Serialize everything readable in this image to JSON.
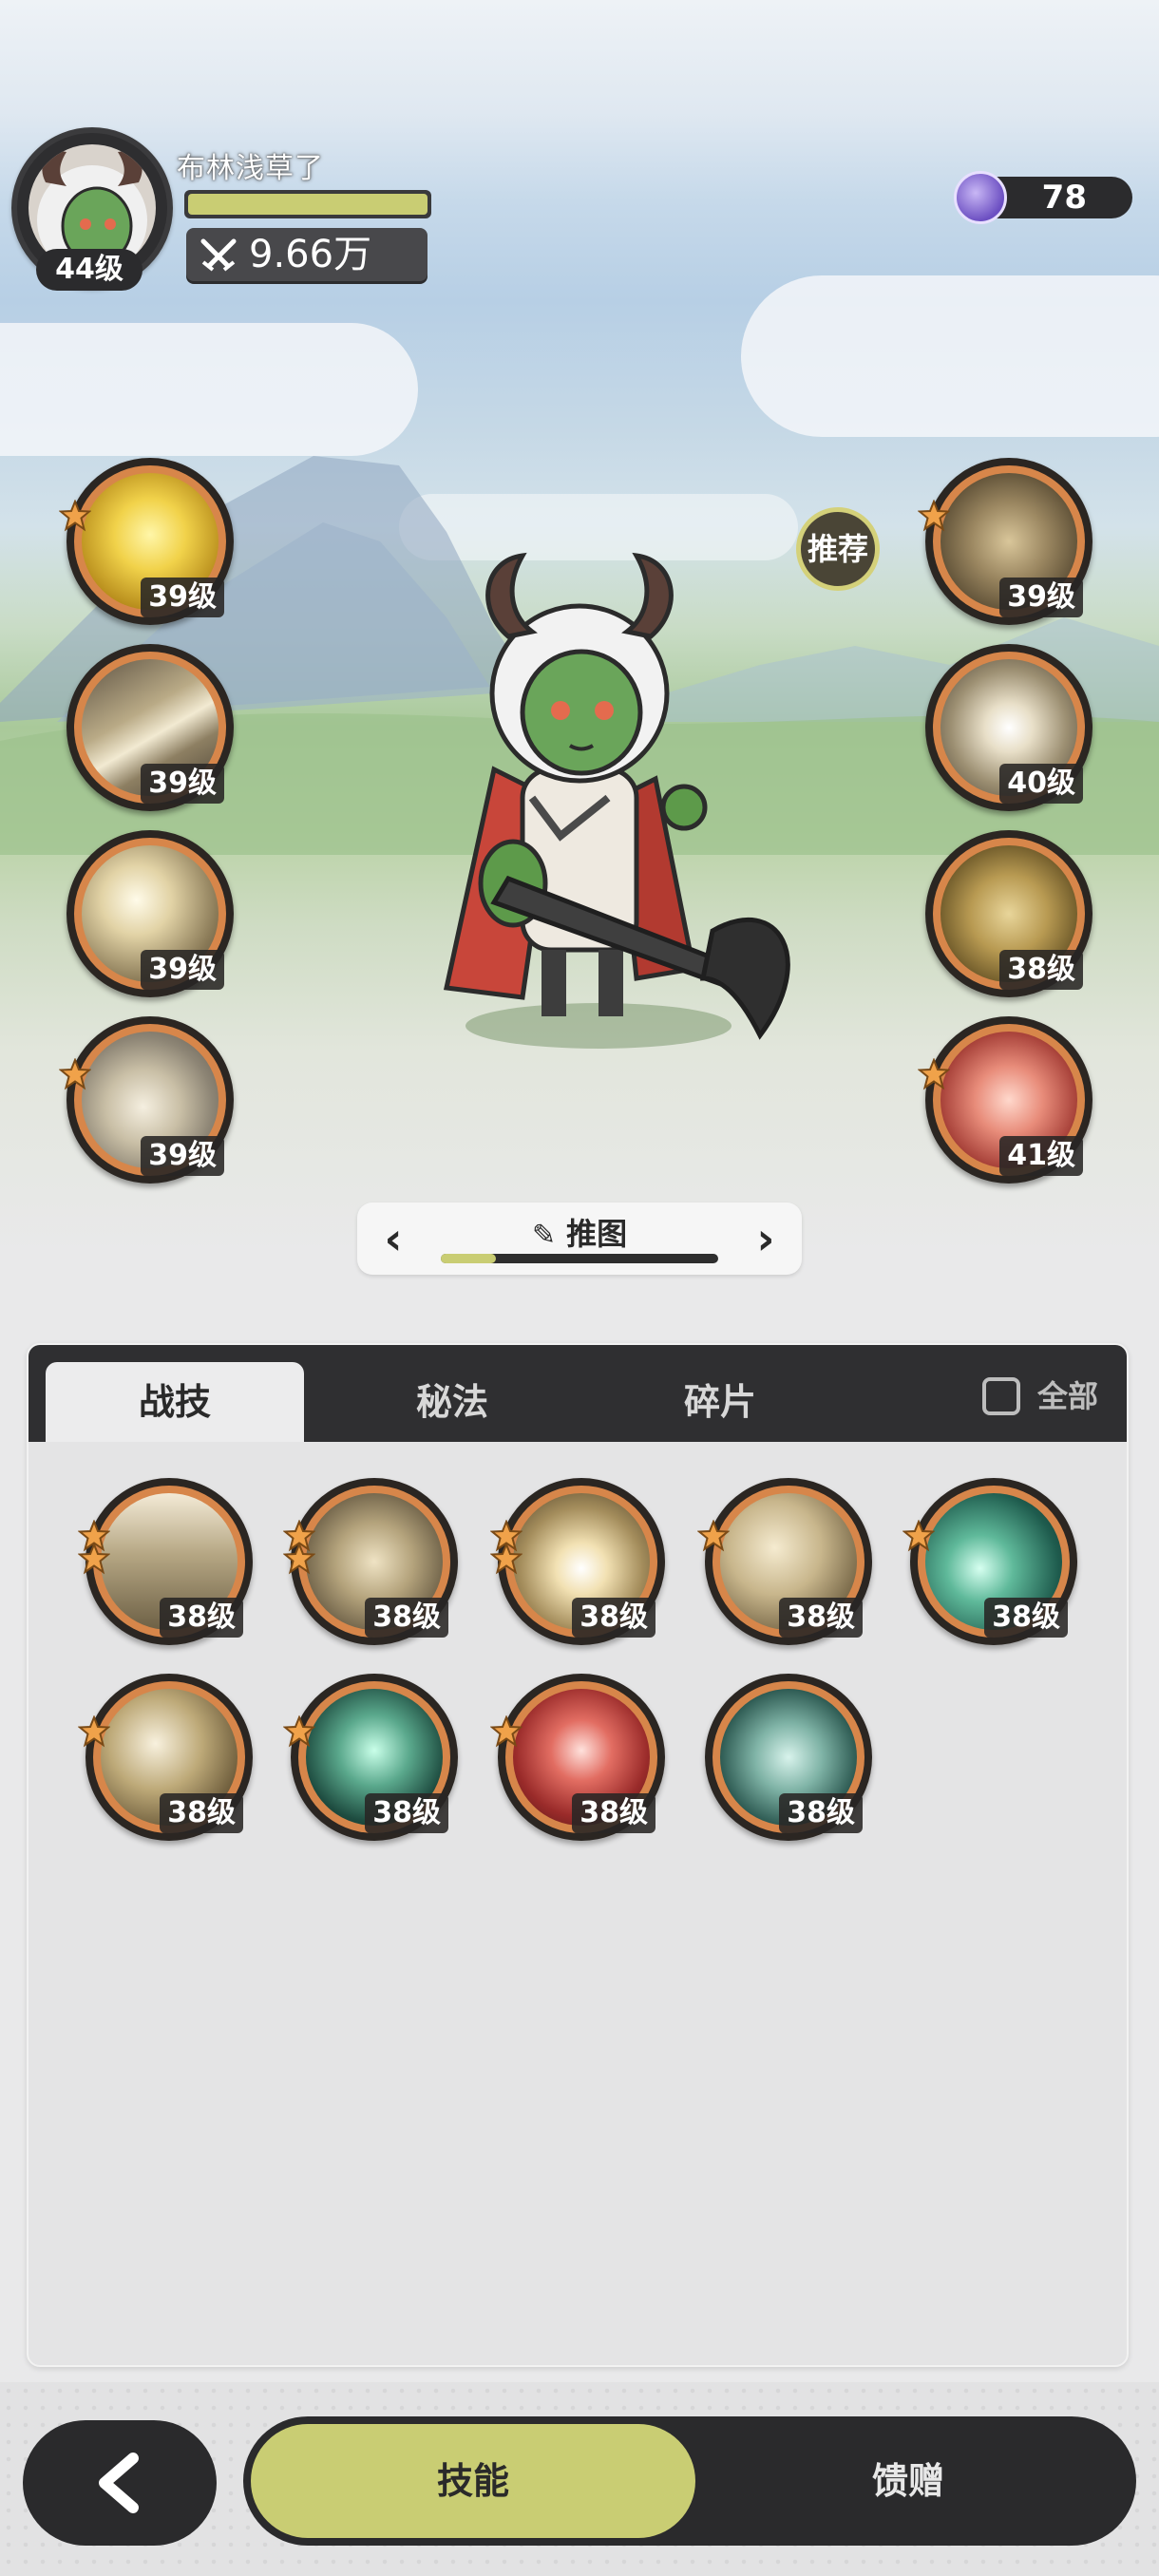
{
  "player": {
    "name": "布林浅草了",
    "level": "44级",
    "power": "9.66万",
    "exp_fraction": 1.0
  },
  "currency": {
    "value": "78",
    "icon": "purple-character-token-icon"
  },
  "recommend_label": "推荐",
  "equipped_left": [
    {
      "level": "39级",
      "starred": true,
      "icon": "golden-pentagon-upgrade-icon"
    },
    {
      "level": "39级",
      "starred": false,
      "icon": "wind-slash-icon"
    },
    {
      "level": "39级",
      "starred": false,
      "icon": "sparkle-sword-icon"
    },
    {
      "level": "39级",
      "starred": true,
      "icon": "charging-beast-icon"
    }
  ],
  "equipped_right": [
    {
      "level": "39级",
      "starred": true,
      "icon": "rock-fist-icon"
    },
    {
      "level": "40级",
      "starred": false,
      "icon": "piercing-blade-icon"
    },
    {
      "level": "38级",
      "starred": false,
      "icon": "armor-shell-icon"
    },
    {
      "level": "41级",
      "starred": true,
      "icon": "red-sword-icon"
    }
  ],
  "stage": {
    "label": "推图",
    "progress_fraction": 0.2
  },
  "tabs": [
    {
      "label": "战技",
      "active": true
    },
    {
      "label": "秘法",
      "active": false
    },
    {
      "label": "碎片",
      "active": false
    }
  ],
  "all_toggle": {
    "label": "全部",
    "checked": false
  },
  "skills": [
    {
      "level": "38级",
      "stars": 2,
      "icon": "claw-burst-icon"
    },
    {
      "level": "38级",
      "stars": 2,
      "icon": "spin-slash-icon"
    },
    {
      "level": "38级",
      "stars": 2,
      "icon": "explosion-icon"
    },
    {
      "level": "38级",
      "stars": 1,
      "icon": "crescent-strike-icon"
    },
    {
      "level": "38级",
      "stars": 1,
      "icon": "green-crescent-icon"
    },
    {
      "level": "38级",
      "stars": 1,
      "icon": "leaping-strike-icon"
    },
    {
      "level": "38级",
      "stars": 1,
      "icon": "spirit-sword-icon"
    },
    {
      "level": "38级",
      "stars": 1,
      "icon": "blood-rage-icon"
    },
    {
      "level": "38级",
      "stars": 0,
      "icon": "spider-web-icon"
    }
  ],
  "bottom_nav": {
    "active": "技能",
    "inactive": "馈赠"
  }
}
